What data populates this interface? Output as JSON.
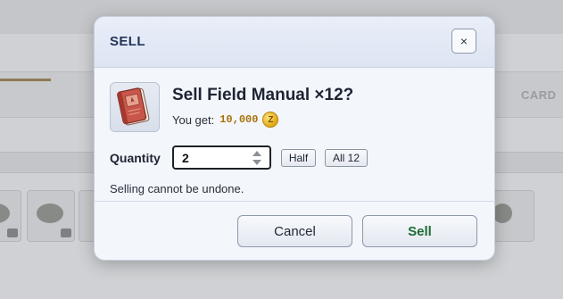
{
  "background": {
    "tab_label": "CARD"
  },
  "dialog": {
    "title": "SELL",
    "close_label": "×",
    "item": {
      "icon": "field-manual-book-icon",
      "heading": "Sell Field Manual ×12?"
    },
    "proceeds": {
      "label": "You get:",
      "amount": "10,000",
      "currency_symbol": "Z"
    },
    "quantity": {
      "label": "Quantity",
      "value": "2",
      "half_label": "Half",
      "all_label": "All 12"
    },
    "warning": "Selling cannot be undone.",
    "actions": {
      "cancel_label": "Cancel",
      "confirm_label": "Sell"
    }
  },
  "colors": {
    "title": "#23345a",
    "amount": "#a77208",
    "confirm": "#1d6b33"
  }
}
